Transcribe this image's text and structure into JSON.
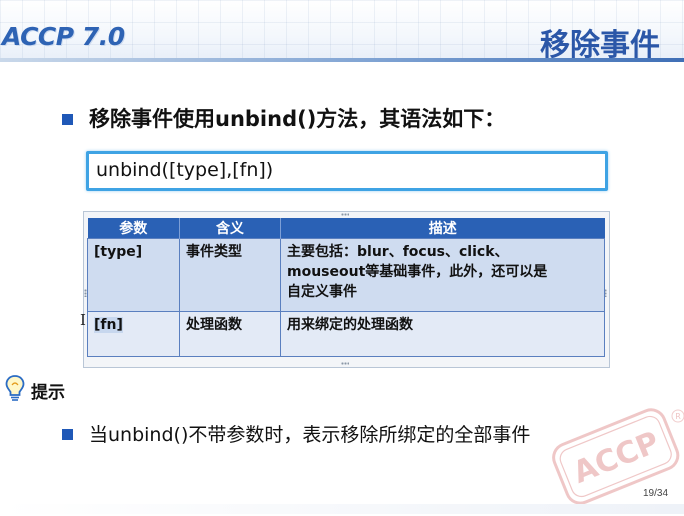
{
  "header": {
    "logo": "ACCP 7.0",
    "title": "移除事件"
  },
  "bullets": [
    {
      "text": "移除事件使用unbind()方法，其语法如下："
    },
    {
      "text": "当unbind()不带参数时，表示移除所绑定的全部事件"
    }
  ],
  "syntax": "unbind([type],[fn])",
  "table": {
    "headers": [
      "参数",
      "含义",
      "描述"
    ],
    "rows": [
      {
        "param": "[type]",
        "meaning": "事件类型",
        "desc_line1": "主要包括：blur、focus、click、",
        "desc_line2": "mouseout等基础事件，此外，还可以是",
        "desc_line3": "自定义事件"
      },
      {
        "param": "[fn]",
        "meaning": "处理函数",
        "desc_line1": "用来绑定的处理函数"
      }
    ]
  },
  "tip": {
    "icon": "lightbulb-icon",
    "label": "提示"
  },
  "footer": {
    "page": "19/34",
    "watermark": "ACCP"
  },
  "colors": {
    "accent": "#2a61b5",
    "title": "#2b57a8",
    "syntax_border": "#3fa3e4",
    "row1": "#cfdcf0",
    "row2": "#e3eaf6"
  }
}
